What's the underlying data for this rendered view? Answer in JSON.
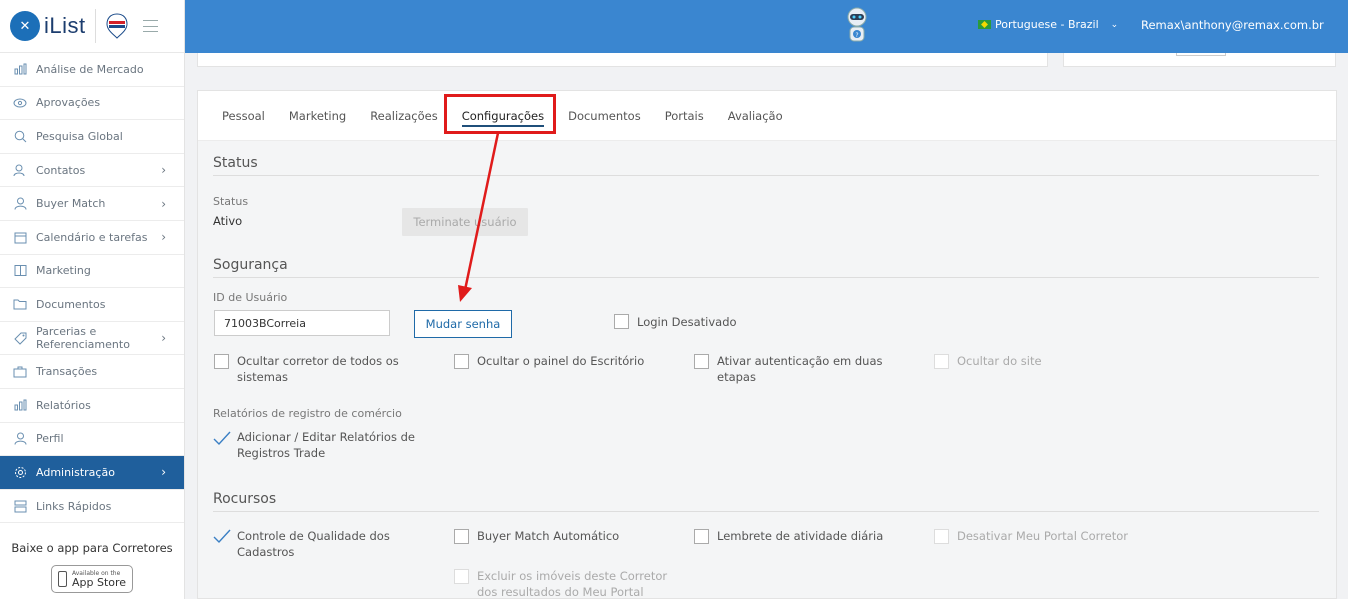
{
  "brand": {
    "name": "iList"
  },
  "sidebar": {
    "items": [
      {
        "label": "Análise de Mercado",
        "icon": "bar-chart-icon",
        "chevron": false
      },
      {
        "label": "Aprovações",
        "icon": "eye-icon",
        "chevron": false
      },
      {
        "label": "Pesquisa Global",
        "icon": "search-icon",
        "chevron": false
      },
      {
        "label": "Contatos",
        "icon": "contacts-icon",
        "chevron": true
      },
      {
        "label": "Buyer Match",
        "icon": "user-icon",
        "chevron": true
      },
      {
        "label": "Calendário e tarefas",
        "icon": "calendar-icon",
        "chevron": true
      },
      {
        "label": "Marketing",
        "icon": "book-icon",
        "chevron": false
      },
      {
        "label": "Documentos",
        "icon": "folder-icon",
        "chevron": false
      },
      {
        "label": "Parcerias e Referenciamento",
        "icon": "tag-icon",
        "chevron": true
      },
      {
        "label": "Transações",
        "icon": "briefcase-icon",
        "chevron": false
      },
      {
        "label": "Relatórios",
        "icon": "bar-chart-icon",
        "chevron": false
      },
      {
        "label": "Perfil",
        "icon": "user-icon",
        "chevron": false
      },
      {
        "label": "Administração",
        "icon": "gear-icon",
        "chevron": true,
        "active": true
      },
      {
        "label": "Links Rápidos",
        "icon": "links-icon",
        "chevron": false
      }
    ],
    "app_text": "Baixe o app para Corretores",
    "appstore_small": "Available on the",
    "appstore_big": "App Store"
  },
  "topbar": {
    "language": "Portuguese - Brazil",
    "user": "Remax\\anthony@remax.com.br"
  },
  "tabs": [
    "Pessoal",
    "Marketing",
    "Realizações",
    "Configurações",
    "Documentos",
    "Portais",
    "Avaliação"
  ],
  "status": {
    "title": "Status",
    "label": "Status",
    "value": "Ativo",
    "terminate_label": "Terminate usuário"
  },
  "security": {
    "title": "Sogurança",
    "user_id_label": "ID de Usuário",
    "user_id_value": "71003BCorreia",
    "change_password": "Mudar senha",
    "login_disabled": "Login Desativado",
    "hide_agent": "Ocultar corretor de todos os sistemas",
    "hide_office_panel": "Ocultar o painel do Escritório",
    "two_factor": "Ativar autenticação em duas etapas",
    "hide_site": "Ocultar do site",
    "trade_reports_label": "Relatórios de registro de comércio",
    "trade_reports_option": "Adicionar / Editar Relatórios de Registros Trade"
  },
  "resources": {
    "title": "Rocursos",
    "quality_control": "Controle de Qualidade dos Cadastros",
    "buyer_match_auto": "Buyer Match Automático",
    "daily_reminder": "Lembrete de atividade diária",
    "disable_portal": "Desativar Meu Portal Corretor",
    "exclude_listings": "Excluir os imóveis deste Corretor dos resultados do Meu Portal"
  },
  "colors": {
    "topbar": "#3a86d0",
    "sidebar_active": "#1f5f9c",
    "highlight": "#e01b1b"
  }
}
